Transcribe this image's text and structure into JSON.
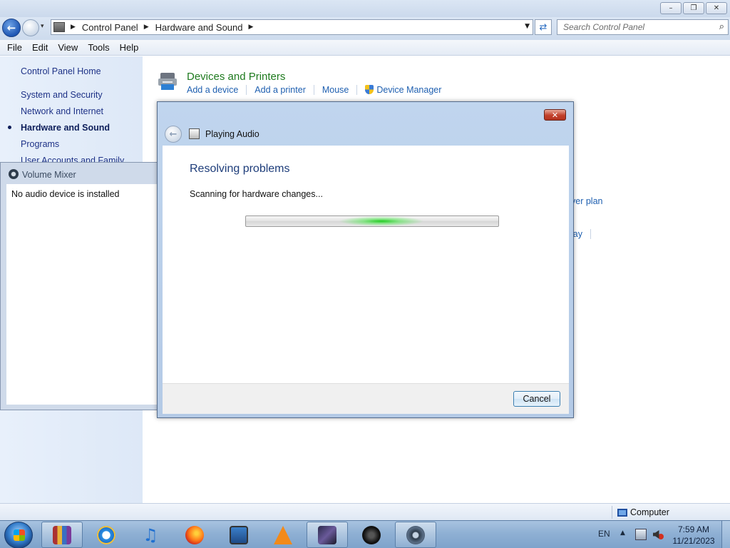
{
  "window": {
    "nav": {
      "breadcrumbs": [
        "Control Panel",
        "Hardware and Sound"
      ],
      "search_placeholder": "Search Control Panel"
    },
    "menu": [
      "File",
      "Edit",
      "View",
      "Tools",
      "Help"
    ],
    "left_nav": {
      "home": "Control Panel Home",
      "items": [
        "System and Security",
        "Network and Internet",
        "Hardware and Sound",
        "Programs",
        "User Accounts and Family"
      ],
      "active_item": "Hardware and Sound"
    },
    "content": {
      "section_title": "Devices and Printers",
      "links": [
        "Add a device",
        "Add a printer",
        "Mouse",
        "Device Manager"
      ],
      "partial_link_1": "ver plan",
      "partial_link_2": "lay"
    },
    "status_bar": {
      "location": "Computer"
    }
  },
  "volume_mixer": {
    "title": "Volume Mixer",
    "message": "No audio device is installed"
  },
  "troubleshooter": {
    "title": "Playing Audio",
    "heading": "Resolving problems",
    "status": "Scanning for hardware changes...",
    "cancel_label": "Cancel"
  },
  "taskbar": {
    "language": "EN",
    "time": "7:59 AM",
    "date": "11/21/2023",
    "apps": [
      "winrar-icon",
      "internet-explorer-icon",
      "itunes-icon",
      "firefox-icon",
      "remote-desktop-icon",
      "vlc-icon",
      "media-player-icon",
      "obs-icon",
      "speaker-app-icon"
    ]
  },
  "colors": {
    "link_blue": "#1e5fb0",
    "section_green": "#1e7a1e",
    "progress_green": "#22cc22",
    "close_red": "#c2402a"
  }
}
